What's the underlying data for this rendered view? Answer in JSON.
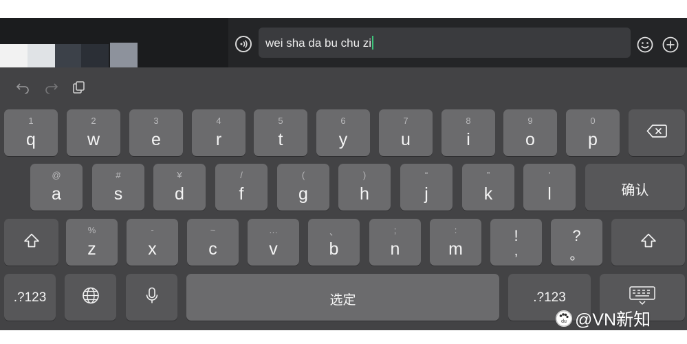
{
  "input": {
    "text": "wei sha da bu chu zi"
  },
  "toolbar": {
    "icons": [
      "undo-icon",
      "redo-icon",
      "clipboard-icon"
    ]
  },
  "keys": {
    "row1": [
      {
        "sec": "1",
        "pri": "q"
      },
      {
        "sec": "2",
        "pri": "w"
      },
      {
        "sec": "3",
        "pri": "e"
      },
      {
        "sec": "4",
        "pri": "r"
      },
      {
        "sec": "5",
        "pri": "t"
      },
      {
        "sec": "6",
        "pri": "y"
      },
      {
        "sec": "7",
        "pri": "u"
      },
      {
        "sec": "8",
        "pri": "i"
      },
      {
        "sec": "9",
        "pri": "o"
      },
      {
        "sec": "0",
        "pri": "p"
      }
    ],
    "row2": [
      {
        "sec": "@",
        "pri": "a"
      },
      {
        "sec": "#",
        "pri": "s"
      },
      {
        "sec": "¥",
        "pri": "d"
      },
      {
        "sec": "/",
        "pri": "f"
      },
      {
        "sec": "(",
        "pri": "g"
      },
      {
        "sec": ")",
        "pri": "h"
      },
      {
        "sec": "“",
        "pri": "j"
      },
      {
        "sec": "”",
        "pri": "k"
      },
      {
        "sec": "'",
        "pri": "l"
      }
    ],
    "row3": [
      {
        "sec": "%",
        "pri": "z"
      },
      {
        "sec": "-",
        "pri": "x"
      },
      {
        "sec": "~",
        "pri": "c"
      },
      {
        "sec": "…",
        "pri": "v"
      },
      {
        "sec": "、",
        "pri": "b"
      },
      {
        "sec": ";",
        "pri": "n"
      },
      {
        "sec": ":",
        "pri": "m"
      }
    ],
    "punct1": {
      "top": "!",
      "bottom": ","
    },
    "punct2": {
      "top": "?",
      "bottom": "。"
    },
    "confirm_label": "确认",
    "numbers_label": ".?123",
    "numbers_label_right": ".?123",
    "space_label": "选定"
  },
  "watermark": {
    "logo_text": "du",
    "text": "@VN新知"
  }
}
